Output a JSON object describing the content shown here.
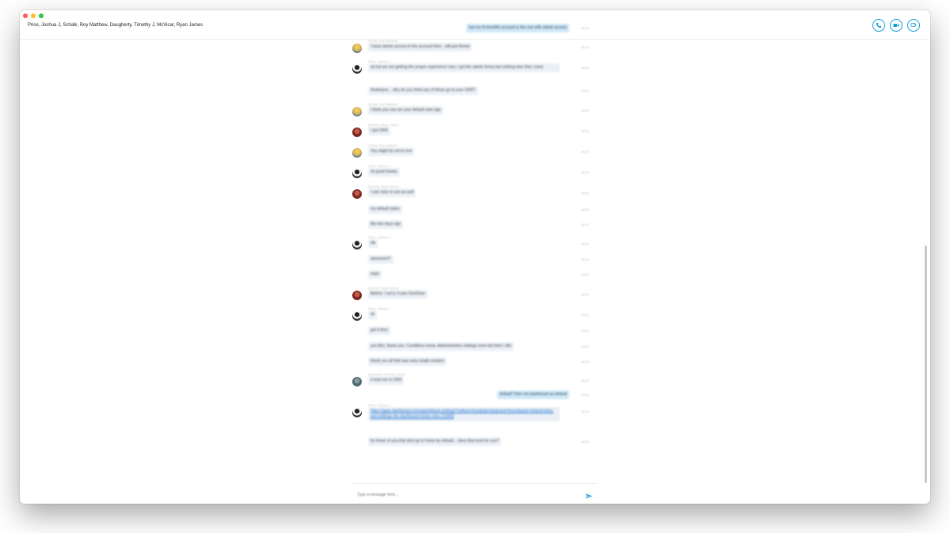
{
  "window": {
    "title": "Price, Joshua J, Schalk, Roy Matthew, Daugherty, Timothy J, McVicar, Ryan James"
  },
  "header": {
    "call_icon": "phone-icon",
    "video_icon": "video-camera-icon",
    "share_icon": "share-screen-icon",
    "accent_color": "#0aa0d8"
  },
  "messages": [
    {
      "time": "08:29",
      "direction": "out",
      "text": "but my ht benefits account is the one with admin access",
      "sender": "",
      "avatar": ""
    },
    {
      "time": "08:30",
      "direction": "in",
      "sender": "Schalk, Roy Matthew",
      "avatar": "yellow",
      "text": "I have admin access to the account then - will just theme"
    },
    {
      "time": "08:30",
      "direction": "in",
      "sender": "Price, Joshua J",
      "avatar": "dark",
      "text": "ok but we are getting the proper experience now, I got the admin forms but nothing else that i need",
      "multiline": true
    },
    {
      "time": "08:30",
      "direction": "in",
      "sender": "",
      "avatar": "",
      "text": "Andrelynn... why do you think any of these go to your OKR?"
    },
    {
      "time": "08:30",
      "direction": "in",
      "sender": "Schalk, Roy Matthew",
      "avatar": "yellow",
      "text": "I think you can set your default start app"
    },
    {
      "time": "08:30",
      "direction": "in",
      "sender": "McVicar, Ryan James",
      "avatar": "red",
      "text": "I got OKR"
    },
    {
      "time": "08:30",
      "direction": "in",
      "sender": "Schalk, Roy Matthew",
      "avatar": "yellow",
      "text": "You might be set to one"
    },
    {
      "time": "08:30",
      "direction": "in",
      "sender": "Price, Joshua J",
      "avatar": "dark",
      "text": "ok good thanks"
    },
    {
      "time": "08:30",
      "direction": "in",
      "sender": "McVicar, Ryan James",
      "avatar": "red",
      "text": "I ask mine to see as well"
    },
    {
      "time": "08:30",
      "direction": "in",
      "sender": "",
      "avatar": "",
      "text": "my default starts"
    },
    {
      "time": "08:31",
      "direction": "in",
      "sender": "",
      "avatar": "",
      "text": "like two days ago"
    },
    {
      "time": "08:31",
      "direction": "in",
      "sender": "Price, Joshua J",
      "avatar": "dark",
      "text": "idk"
    },
    {
      "time": "08:31",
      "direction": "in",
      "sender": "",
      "avatar": "",
      "text": "awesome!!!"
    },
    {
      "time": "08:31",
      "direction": "in",
      "sender": "",
      "avatar": "",
      "text": "nope"
    },
    {
      "time": "08:31",
      "direction": "in",
      "sender": "McVicar, Ryan James",
      "avatar": "red",
      "text": "Before, I set it, it was OneDrive"
    },
    {
      "time": "08:31",
      "direction": "in",
      "sender": "Price, Joshua J",
      "avatar": "dark",
      "text": "ok"
    },
    {
      "time": "08:31",
      "direction": "in",
      "sender": "",
      "avatar": "",
      "text": "got it then"
    },
    {
      "time": "08:32",
      "direction": "in",
      "sender": "",
      "avatar": "",
      "text": "yes Ben, thank you. Conditions know. Administration settings even but then I did."
    },
    {
      "time": "08:33",
      "direction": "in",
      "sender": "",
      "avatar": "",
      "text": "thank you all that was easy single solution"
    },
    {
      "time": "08:33",
      "direction": "in",
      "sender": "Daugherty, Timothy James",
      "avatar": "grey",
      "text": "it took me to OKR"
    },
    {
      "time": "08:33",
      "direction": "out",
      "sender": "",
      "avatar": "",
      "text": "default? then set dashboard as default"
    },
    {
      "time": "08:34",
      "direction": "in",
      "sender": "Price, Joshua J",
      "avatar": "dark",
      "text": "https://apps.dashboard.com/app/default-settings?redirect=true&tab=okr&view=home&user=shared-links-and-settings-okr-dashboard-home-view-123456",
      "link": true
    },
    {
      "time": "08:34",
      "direction": "in",
      "sender": "",
      "avatar": "",
      "text": "for those of you that dont go to home by default... does that work for you?"
    }
  ],
  "composer": {
    "placeholder": "Type a message here...",
    "send_icon": "send-icon"
  }
}
